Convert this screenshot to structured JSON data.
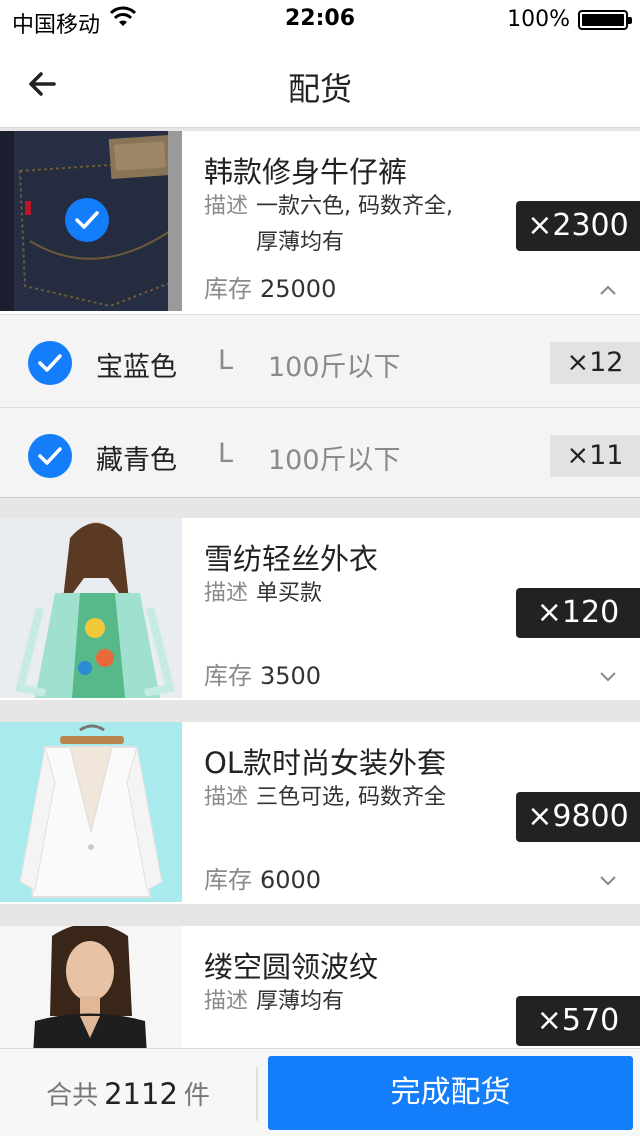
{
  "status_bar": {
    "carrier": "中国移动",
    "time": "22:06",
    "battery": "100%"
  },
  "nav": {
    "title": "配货"
  },
  "labels": {
    "desc": "描述",
    "stock": "库存"
  },
  "products": [
    {
      "name": "韩款修身牛仔裤",
      "desc": "一款六色, 码数齐全, 厚薄均有",
      "stock": "25000",
      "qty": "×2300"
    },
    {
      "name": "雪纺轻丝外衣",
      "desc": "单买款",
      "stock": "3500",
      "qty": "×120"
    },
    {
      "name": "OL款时尚女装外套",
      "desc": "三色可选, 码数齐全",
      "stock": "6000",
      "qty": "×9800"
    },
    {
      "name": "缕空圆领波纹",
      "desc": "厚薄均有",
      "qty": "×570"
    }
  ],
  "variants": [
    {
      "color": "宝蓝色",
      "size": "L",
      "weight": "100斤以下",
      "qty": "×12"
    },
    {
      "color": "藏青色",
      "size": "L",
      "weight": "100斤以下",
      "qty": "×11"
    }
  ],
  "footer": {
    "total_prefix": "合共",
    "total_count": "2112",
    "total_unit": "件",
    "finish_label": "完成配货"
  },
  "colors": {
    "accent": "#137dfa",
    "badge": "#222222"
  },
  "icons": {
    "back": "arrow-left-icon",
    "expand": "chevron-down-icon",
    "collapse": "chevron-up-icon",
    "check": "checkmark-circle-icon"
  }
}
